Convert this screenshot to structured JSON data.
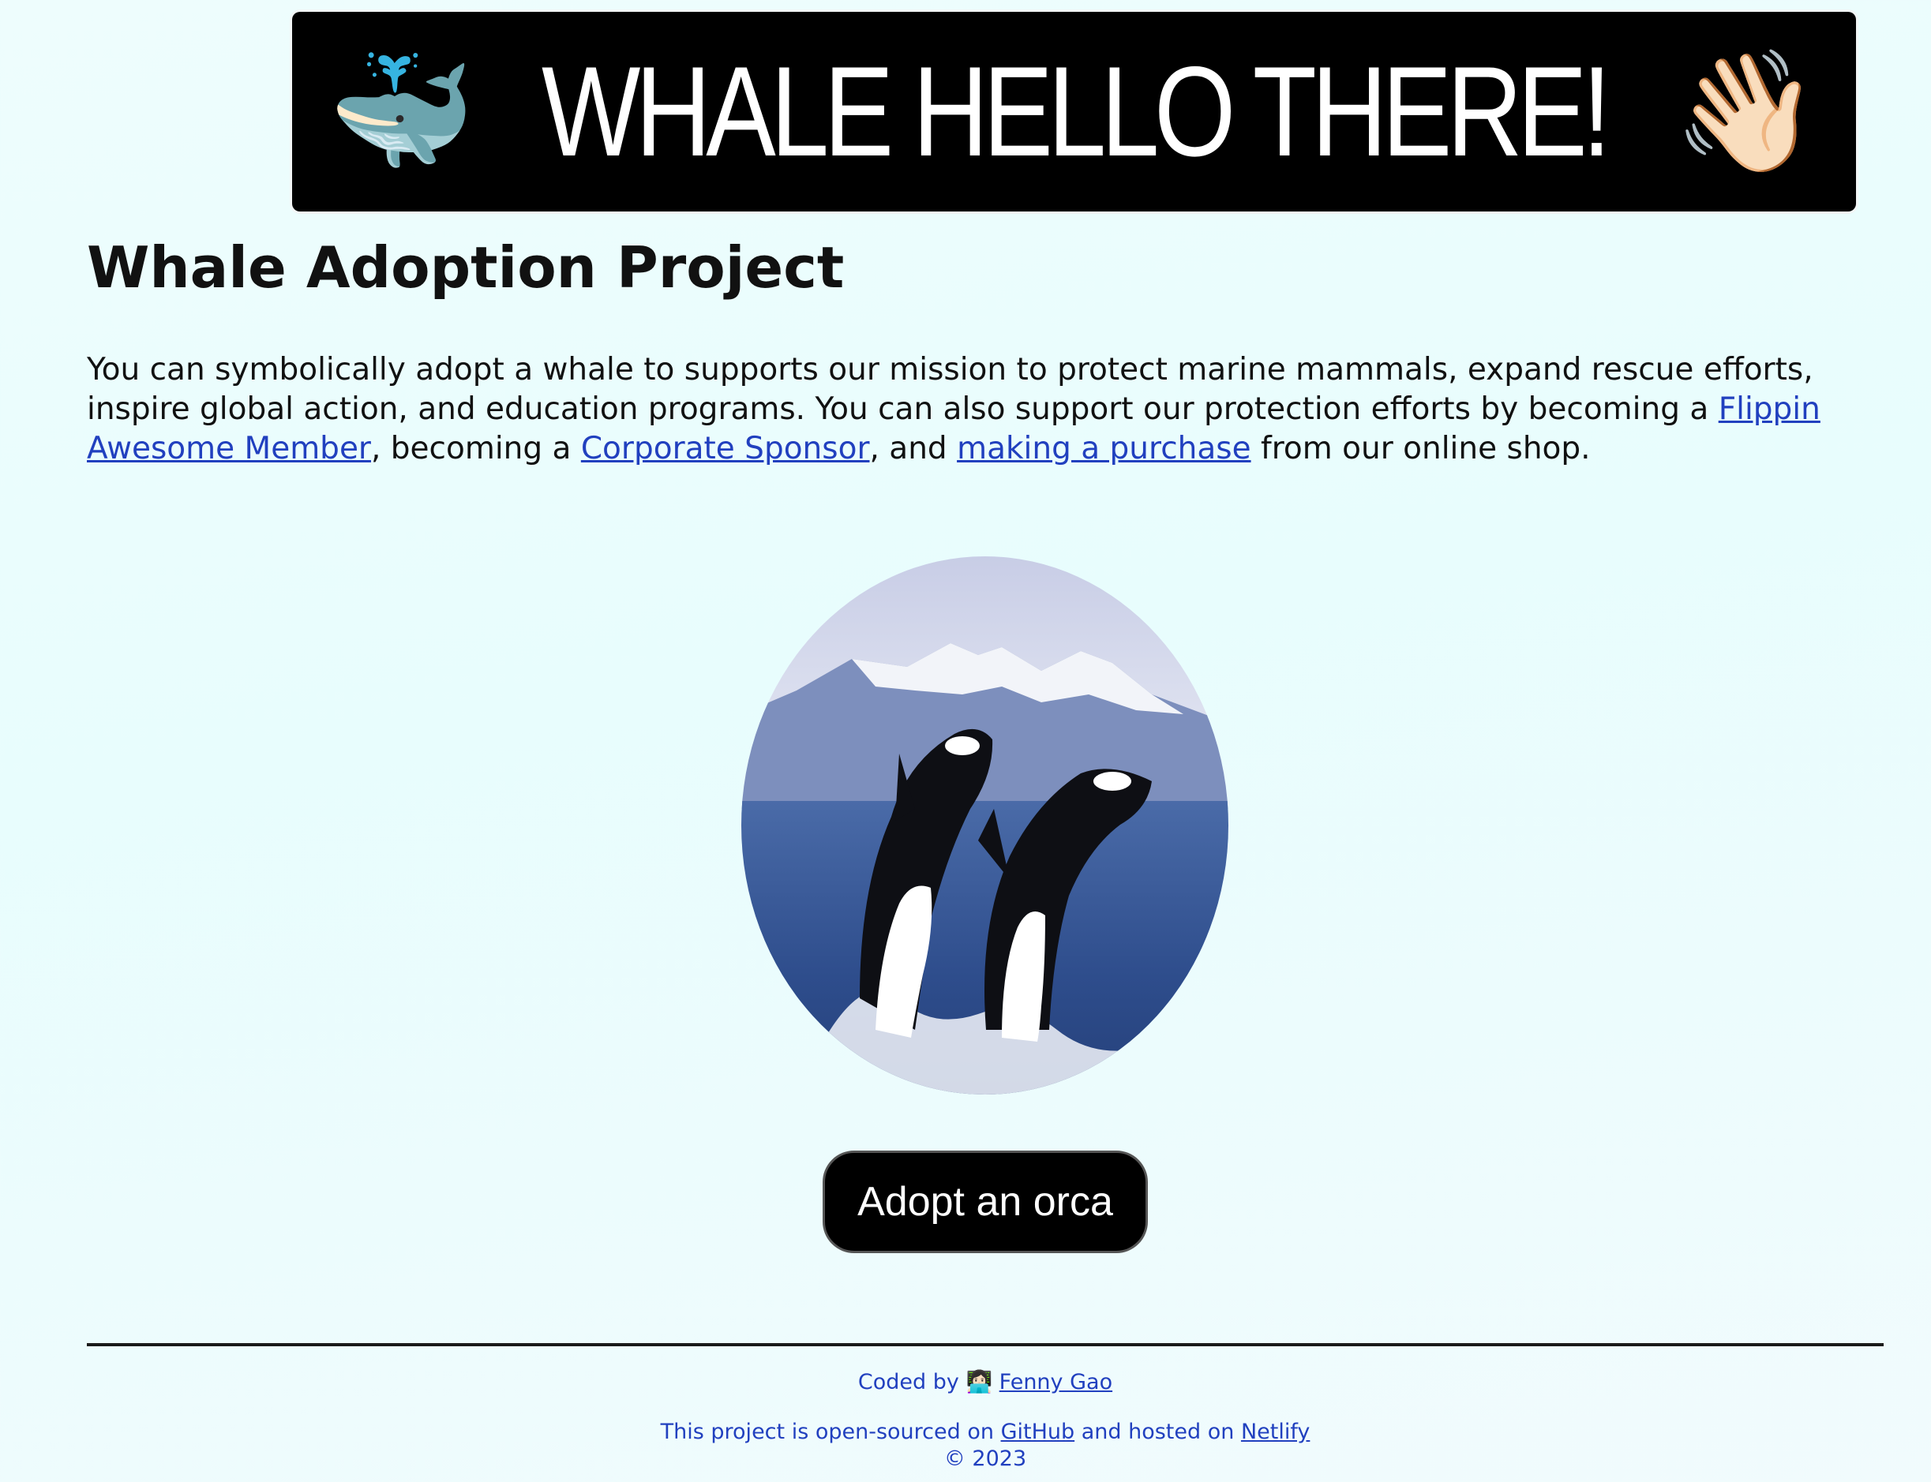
{
  "banner": {
    "left_emoji": "🐳",
    "text": "WHALE HELLO THERE!",
    "right_emoji": "👋🏻"
  },
  "page": {
    "title": "Whale Adoption Project"
  },
  "intro": {
    "text_1": "You can symbolically adopt a whale to supports our mission to protect marine mammals, expand rescue efforts, inspire global action, and education programs. You can also support our protection efforts by becoming a ",
    "link_membership": "Flippin Awesome Member",
    "text_2": ", becoming a ",
    "link_sponsor": "Corporate Sponsor",
    "text_3": ", and ",
    "link_purchase": "making a purchase",
    "text_4": " from our online shop."
  },
  "hero": {
    "image_icon": "orca-image"
  },
  "cta": {
    "label": "Adopt an orca"
  },
  "footer": {
    "coded_by": "Coded by ",
    "author_emoji": "👩🏻‍💻",
    "author_link": "Fenny Gao",
    "source_text_1": "This project is open-sourced on ",
    "github_link": "GitHub",
    "source_text_2": " and hosted on ",
    "netlify_link": "Netlify",
    "copyright": "© 2023"
  },
  "colors": {
    "background": "#e8fdfd",
    "link": "#2140bf",
    "banner": "#000000",
    "button": "#000000"
  }
}
